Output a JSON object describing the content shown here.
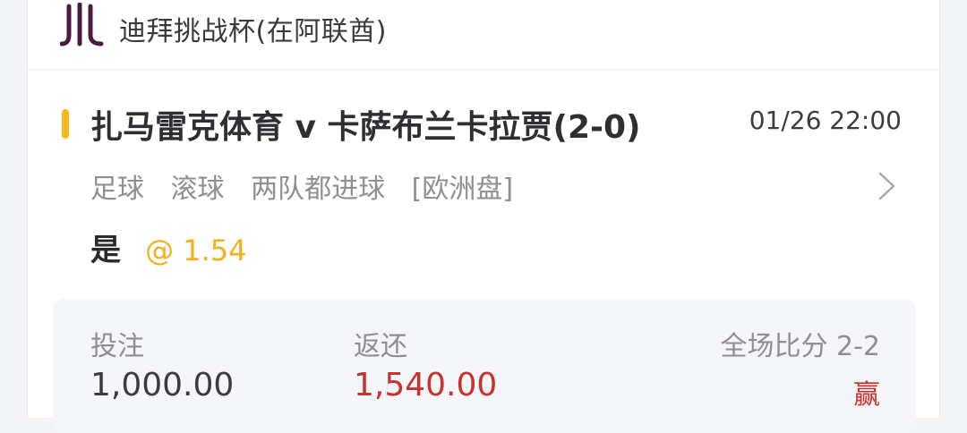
{
  "league": "迪拜挑战杯(在阿联酋)",
  "match": {
    "title": "扎马雷克体育 v 卡萨布兰卡拉贾(2-0)",
    "time": "01/26 22:00"
  },
  "market": {
    "sport": "足球",
    "mode": "滚球",
    "bet_type": "两队都进球",
    "odds_format": "[欧洲盘]"
  },
  "selection": {
    "pick": "是",
    "odds": "@ 1.54"
  },
  "summary": {
    "stake_label": "投注",
    "stake_value": "1,000.00",
    "return_label": "返还",
    "return_value": "1,540.00",
    "score_label": "全场比分 2-2",
    "result": "赢"
  },
  "colors": {
    "accent": "#f6b81a",
    "odds": "#f2b11a",
    "win": "#c8312d",
    "logo": "#4b1a3f"
  },
  "icons": {
    "logo": "brand-logo-icon",
    "chevron": "chevron-right-icon"
  }
}
